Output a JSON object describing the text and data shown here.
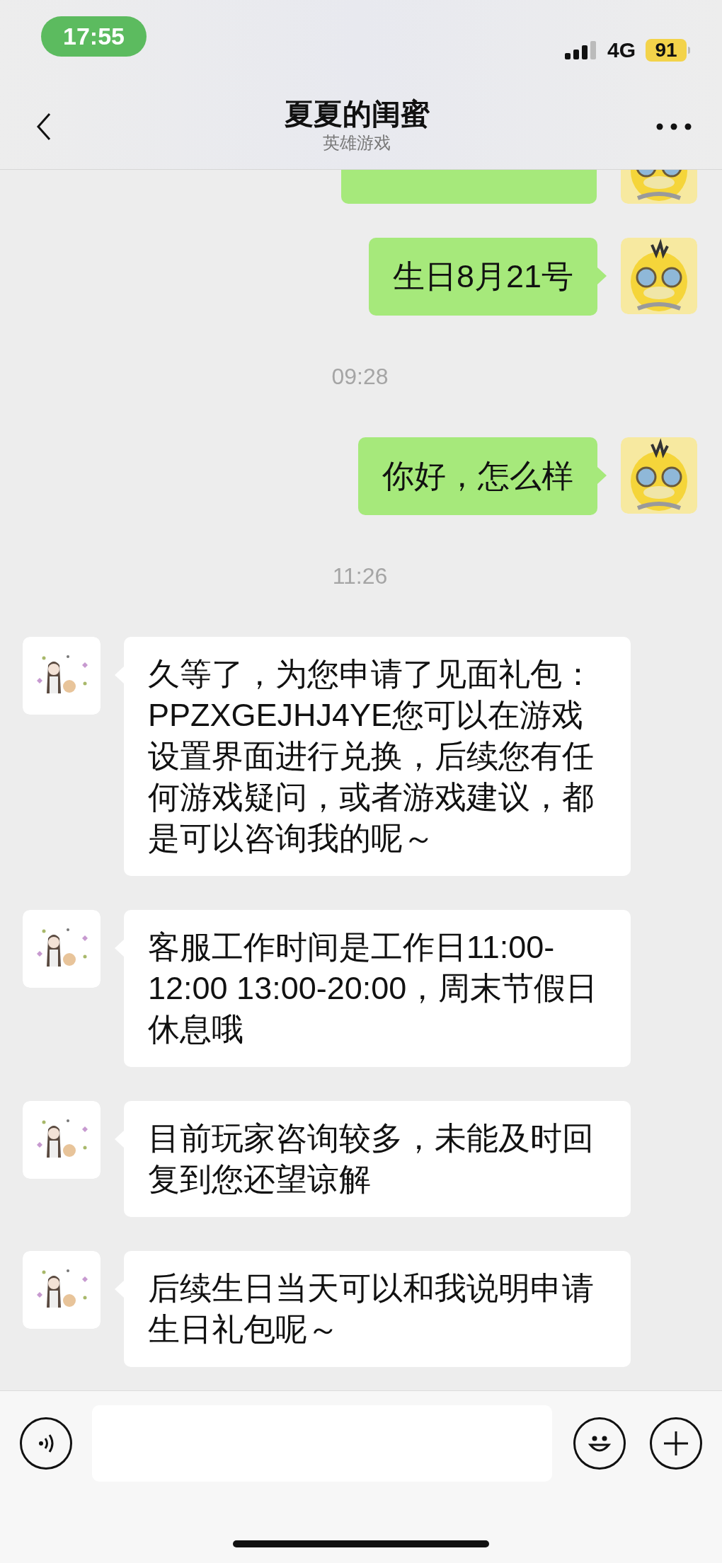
{
  "status_bar": {
    "time": "17:55",
    "network": "4G",
    "battery": "91"
  },
  "header": {
    "title": "夏夏的闺蜜",
    "subtitle": "英雄游戏"
  },
  "messages": [
    {
      "kind": "outgoing_cut"
    },
    {
      "kind": "outgoing",
      "text": "生日8月21号"
    },
    {
      "kind": "time",
      "text": "09:28"
    },
    {
      "kind": "outgoing",
      "text": "你好，怎么样"
    },
    {
      "kind": "time",
      "text": "11:26"
    },
    {
      "kind": "incoming",
      "text": "久等了，为您申请了见面礼包：PPZXGEJHJ4YE您可以在游戏设置界面进行兑换，后续您有任何游戏疑问，或者游戏建议，都是可以咨询我的呢～"
    },
    {
      "kind": "incoming",
      "text": "客服工作时间是工作日11:00-12:00 13:00-20:00，周末节假日休息哦"
    },
    {
      "kind": "incoming",
      "text": "目前玩家咨询较多，未能及时回复到您还望谅解"
    },
    {
      "kind": "incoming",
      "text": "后续生日当天可以和我说明申请生日礼包呢～"
    }
  ]
}
